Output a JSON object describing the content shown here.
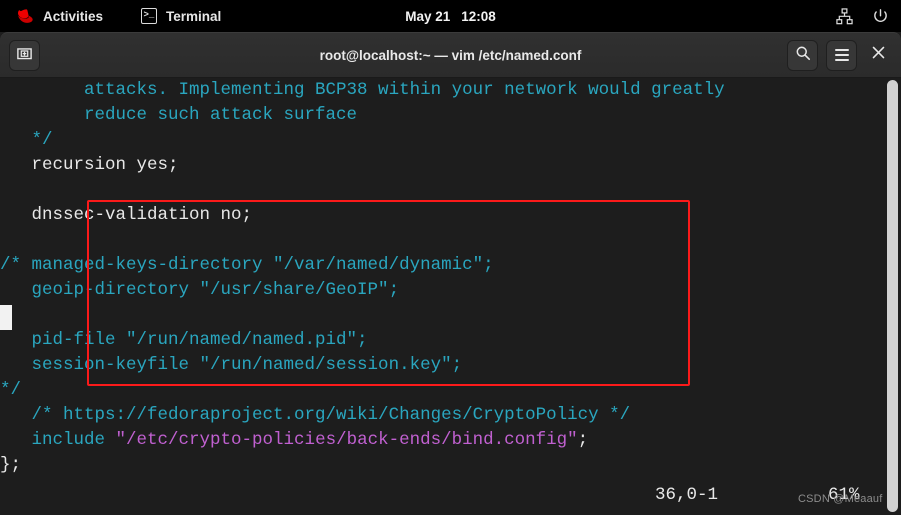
{
  "topbar": {
    "activities_label": "Activities",
    "app_label": "Terminal",
    "redhat_icon": "redhat-logo-icon",
    "terminal_icon": "terminal-prompt-icon",
    "date": "May 21",
    "time": "12:08",
    "network_icon": "network-wired-icon",
    "power_icon": "power-icon"
  },
  "window": {
    "title": "root@localhost:~ — vim /etc/named.conf",
    "new_tab_icon": "new-tab-icon",
    "search_icon": "search-icon",
    "menu_icon": "hamburger-menu-icon",
    "close_icon": "close-icon"
  },
  "terminal": {
    "lines": [
      {
        "id": "l1",
        "segments": [
          {
            "text": "        attacks. Implementing BCP38 within your network would greatly",
            "color": "cyan"
          }
        ]
      },
      {
        "id": "l2",
        "segments": [
          {
            "text": "        reduce such attack surface",
            "color": "cyan"
          }
        ]
      },
      {
        "id": "l3",
        "segments": [
          {
            "text": "   */",
            "color": "cyan"
          }
        ]
      },
      {
        "id": "l4",
        "segments": [
          {
            "text": "   recursion yes;",
            "color": "white"
          }
        ]
      },
      {
        "id": "l5",
        "segments": [
          {
            "text": "",
            "color": "white"
          }
        ]
      },
      {
        "id": "l6",
        "segments": [
          {
            "text": "   dnssec-validation no;",
            "color": "white"
          }
        ]
      },
      {
        "id": "l7",
        "segments": [
          {
            "text": "",
            "color": "white"
          }
        ]
      },
      {
        "id": "l8",
        "segments": [
          {
            "text": "/* managed-keys-directory \"/var/named/dynamic\";",
            "color": "cyan"
          }
        ]
      },
      {
        "id": "l9",
        "segments": [
          {
            "text": "   geoip-directory \"/usr/share/GeoIP\";",
            "color": "cyan"
          }
        ]
      },
      {
        "id": "l10",
        "segments": [
          {
            "text": "",
            "color": "white"
          }
        ]
      },
      {
        "id": "l11",
        "segments": [
          {
            "text": "   pid-file \"/run/named/named.pid\";",
            "color": "cyan"
          }
        ]
      },
      {
        "id": "l12",
        "segments": [
          {
            "text": "   session-keyfile \"/run/named/session.key\";",
            "color": "cyan"
          }
        ]
      },
      {
        "id": "l13",
        "segments": [
          {
            "text": "*/",
            "color": "cyan"
          }
        ]
      },
      {
        "id": "l14",
        "segments": [
          {
            "text": "   /* https://fedoraproject.org/wiki/Changes/CryptoPolicy */",
            "color": "cyan"
          }
        ]
      },
      {
        "id": "l15",
        "segments": [
          {
            "text": "   include ",
            "color": "cyan"
          },
          {
            "text": "\"/etc/crypto-policies/back-ends/bind.config\"",
            "color": "magenta"
          },
          {
            "text": ";",
            "color": "white"
          }
        ]
      },
      {
        "id": "l16",
        "segments": [
          {
            "text": "};",
            "color": "white"
          }
        ]
      }
    ],
    "status": {
      "cursor_position": "36,0-1",
      "scroll_percent": "61%"
    },
    "watermark": "CSDN @Meaauf"
  },
  "colors": {
    "cyan": "#2aa6bf",
    "magenta": "#c060d0",
    "white": "#e8e8e8",
    "background": "#1d1d1d",
    "annotation_red": "#fb1a1a",
    "topbar_background": "#000000",
    "titlebar_background": "#2f2f2f"
  }
}
